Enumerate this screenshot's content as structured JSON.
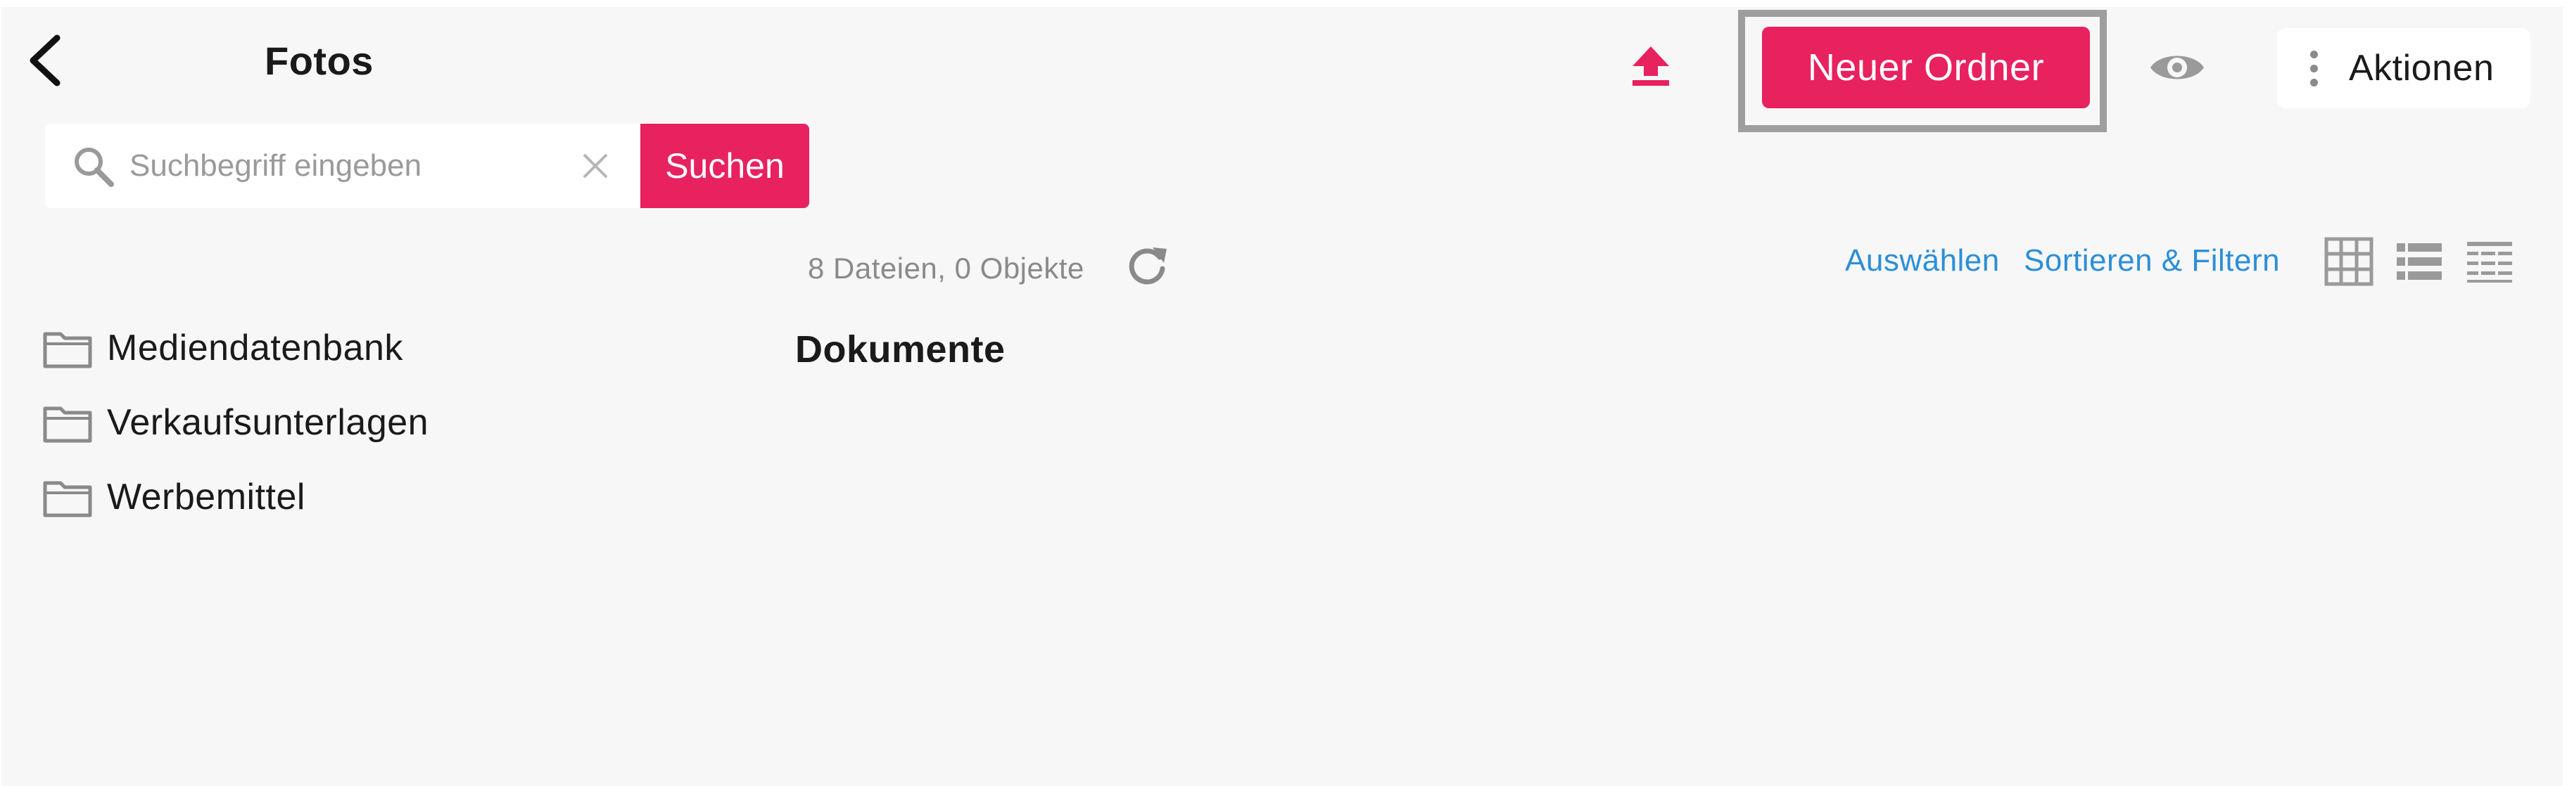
{
  "header": {
    "title": "Fotos",
    "new_folder_label": "Neuer Ordner",
    "actions_label": "Aktionen"
  },
  "search": {
    "placeholder": "Suchbegriff eingeben",
    "value": "",
    "button_label": "Suchen"
  },
  "sidebar": {
    "folders": [
      {
        "label": "Mediendatenbank",
        "icon": "folder-icon"
      },
      {
        "label": "Verkaufsunterlagen",
        "icon": "folder-icon"
      },
      {
        "label": "Werbemittel",
        "icon": "folder-icon"
      }
    ]
  },
  "content": {
    "file_count": "8 Dateien, 0 Objekte",
    "select_label": "Auswählen",
    "sort_filter_label": "Sortieren & Filtern",
    "section_title": "Dokumente",
    "view_modes": [
      "grid-view-icon",
      "list-view-icon",
      "table-view-icon"
    ]
  },
  "colors": {
    "accent": "#e8215f",
    "link": "#2b8fd8",
    "highlight_border": "#9e9e9e",
    "background": "#f7f7f7"
  }
}
